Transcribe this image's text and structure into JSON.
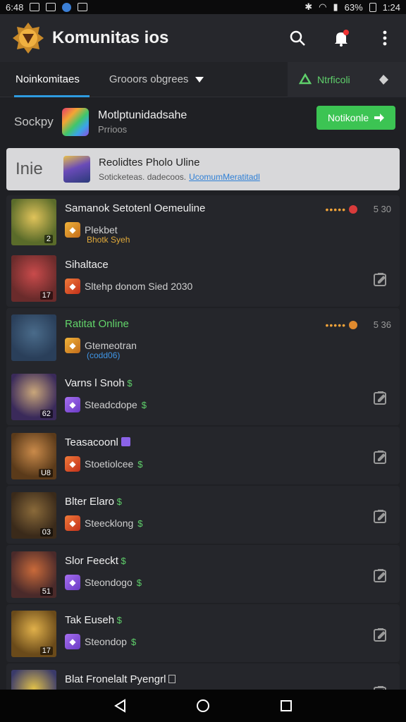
{
  "status_bar": {
    "left_text": "6:48",
    "right_signal": "63%",
    "time": "1:24"
  },
  "app_bar": {
    "title": "Komunitas ios",
    "logo_icon": "gear-emblem-logo",
    "icons": [
      "search-icon",
      "notification-bell-icon",
      "overflow-menu-icon"
    ]
  },
  "tabs": {
    "active": "Noinkomitaes",
    "dropdown": "Grooors obgrees",
    "right_label": "Ntrficoli"
  },
  "filter": {
    "label": "Sockpy",
    "title": "Motlptunidadsahe",
    "subtitle": "Prrioos",
    "button_label": "Notikonle"
  },
  "highlight": {
    "label": "Inie",
    "title": "Reolidtes Pholo Uline",
    "sub_text": "Soticketeas. dadecoos.",
    "link_text": "UcomumMeratitadl"
  },
  "items": [
    {
      "name": "Samanok Setotenl Oemeuline",
      "green": false,
      "tag": "Plekbet",
      "tag2": "Bhotk Syeh",
      "num": "2",
      "time": "5 30",
      "dot_color": "#d93b3b",
      "kind": "online"
    },
    {
      "name": "Sihaltace",
      "green": false,
      "tag": "Sltehp donom Sied 2030",
      "num": "17",
      "kind": "edit"
    },
    {
      "name": "Ratitat Online",
      "green": true,
      "tag": "Gtemeotran",
      "tag2": "(codd06)",
      "num": "",
      "time": "5 36",
      "dot_color": "#e08a2e",
      "kind": "online"
    },
    {
      "name": "Varns l Snoh",
      "green": false,
      "tag": "Steadcdope",
      "num": "62",
      "kind": "edit"
    },
    {
      "name": "Teasacoonl",
      "green": false,
      "tag": "Stoetiolcee",
      "num": "U8",
      "kind": "edit"
    },
    {
      "name": "Blter Elaro",
      "green": false,
      "tag": "Steecklong",
      "num": "03",
      "kind": "edit"
    },
    {
      "name": "Slor Feeckt",
      "green": false,
      "tag": "Steondogo",
      "num": "51",
      "kind": "edit"
    },
    {
      "name": "Tak Euseh",
      "green": false,
      "tag": "Steondop",
      "num": "17",
      "kind": "edit"
    },
    {
      "name": "Blat Fronelalt Pyengrl",
      "green": false,
      "tag": "",
      "num": "",
      "kind": "edit"
    }
  ],
  "nav": [
    "back-icon",
    "home-icon",
    "recents-icon"
  ],
  "colors": {
    "accent_green": "#3cc453",
    "accent_blue": "#2e9be0",
    "background": "#1f2024"
  }
}
